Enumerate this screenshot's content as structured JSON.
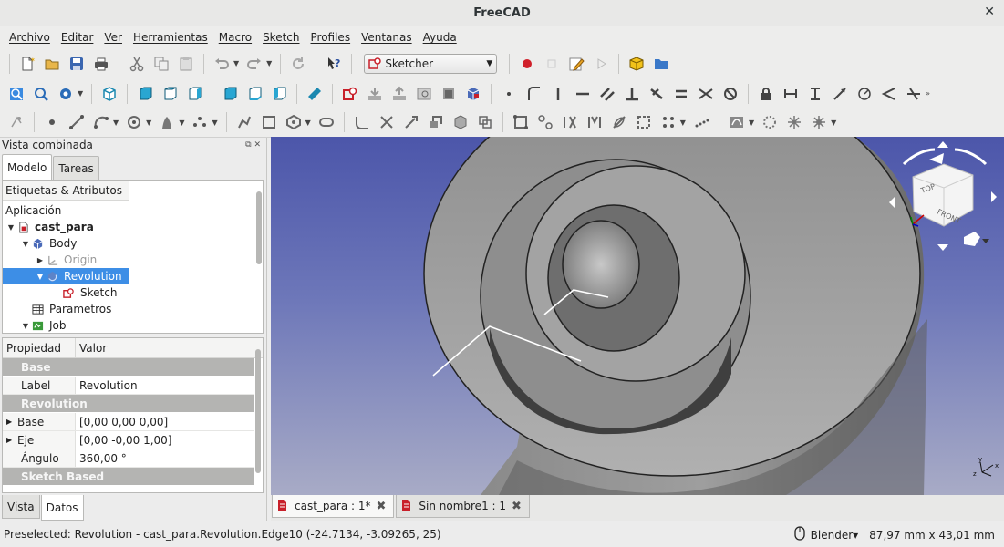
{
  "window": {
    "title": "FreeCAD"
  },
  "menu": [
    "Archivo",
    "Editar",
    "Ver",
    "Herramientas",
    "Macro",
    "Sketch",
    "Profiles",
    "Ventanas",
    "Ayuda"
  ],
  "workbench": {
    "selected": "Sketcher"
  },
  "panel": {
    "title": "Vista combinada",
    "tabs": [
      "Modelo",
      "Tareas"
    ],
    "tree_header": "Etiquetas & Atributos",
    "tree_section": "Aplicación",
    "tree": [
      {
        "label": "cast_para",
        "icon": "document-icon"
      },
      {
        "label": "Body",
        "icon": "body-icon"
      },
      {
        "label": "Origin",
        "icon": "origin-icon"
      },
      {
        "label": "Revolution",
        "icon": "revolution-icon"
      },
      {
        "label": "Sketch",
        "icon": "sketch-icon"
      },
      {
        "label": "Parametros",
        "icon": "spreadsheet-icon"
      },
      {
        "label": "Job",
        "icon": "job-icon"
      }
    ],
    "prop_headers": [
      "Propiedad",
      "Valor"
    ],
    "props": {
      "group_base": "Base",
      "label_key": "Label",
      "label_val": "Revolution",
      "group_revolution": "Revolution",
      "base_key": "Base",
      "base_val": "[0,00 0,00 0,00]",
      "eje_key": "Eje",
      "eje_val": "[0,00 -0,00 1,00]",
      "angulo_key": "Ángulo",
      "angulo_val": "360,00 °",
      "group_sketch": "Sketch Based"
    },
    "bottom_tabs": [
      "Vista",
      "Datos"
    ]
  },
  "navcube": {
    "top": "TOP",
    "front": "FRONT",
    "right": "RIGHT"
  },
  "doc_tabs": [
    "cast_para : 1*",
    "Sin nombre1 : 1"
  ],
  "status": {
    "message": "Preselected: Revolution - cast_para.Revolution.Edge10 (-24.7134, -3.09265, 25)",
    "nav_style": "Blender",
    "dimensions": "87,97 mm x 43,01 mm"
  },
  "colors": {
    "selection": "#3d8ee6",
    "record": "#d0202a",
    "viewport_top": "#4c56aa",
    "viewport_bottom": "#a8abc6"
  }
}
